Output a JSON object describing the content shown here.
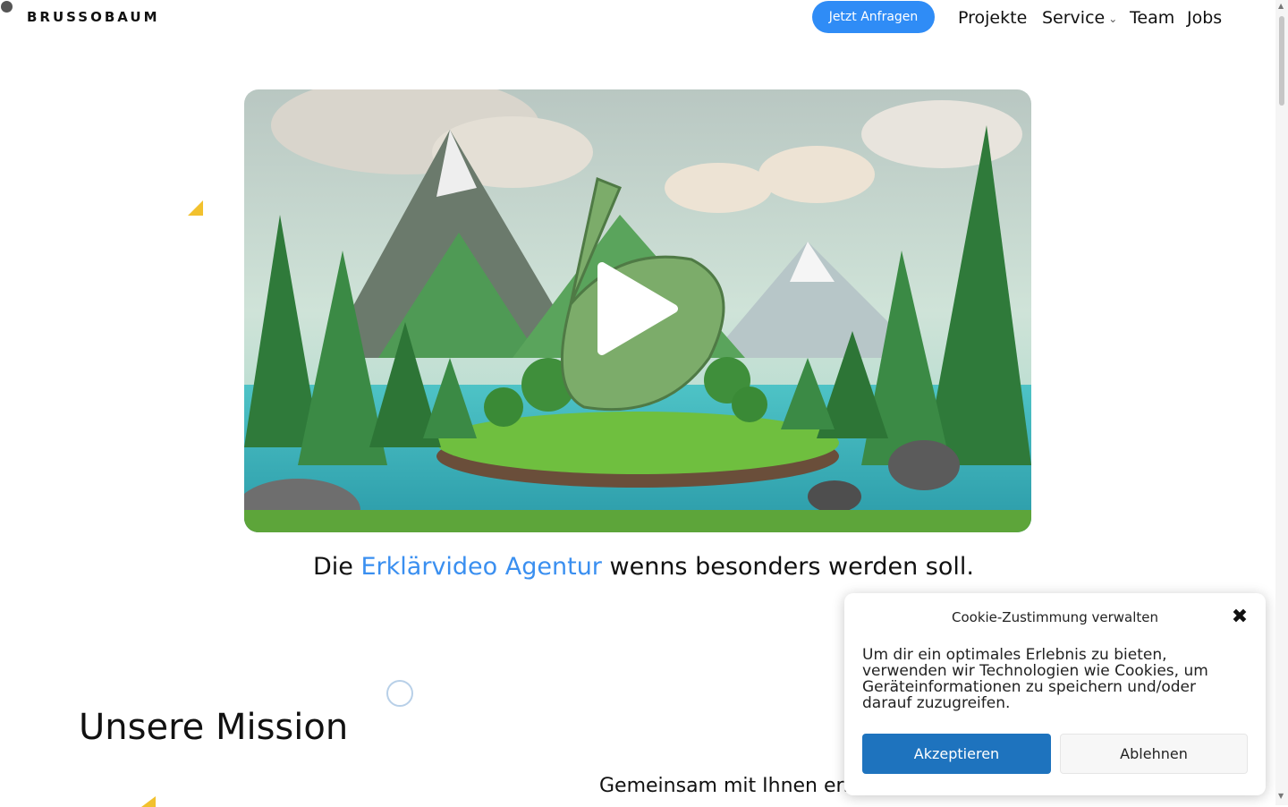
{
  "header": {
    "logo": "BRUSSOBAUM",
    "cta_label": "Jetzt Anfragen",
    "nav": {
      "projekte": "Projekte",
      "service": "Service",
      "team": "Team",
      "jobs": "Jobs"
    }
  },
  "hero": {
    "video_play_icon": "play-icon",
    "tagline_pre": "Die",
    "tagline_highlight": "Erklärvideo Agentur",
    "tagline_post": "wenns besonders werden soll."
  },
  "mission": {
    "title": "Unsere Mission",
    "text": "Gemeinsam mit Ihnen ers"
  },
  "cookie": {
    "title": "Cookie-Zustimmung verwalten",
    "text": "Um dir ein optimales Erlebnis zu bieten, verwenden wir Technologien wie Cookies, um Geräteinformationen zu speichern und/oder darauf zuzugreifen.",
    "accept": "Akzeptieren",
    "deny": "Ablehnen",
    "close_icon": "close-icon"
  },
  "colors": {
    "accent": "#2f8cf6",
    "highlight": "#3a8ff0",
    "accept_button": "#1e73be"
  }
}
